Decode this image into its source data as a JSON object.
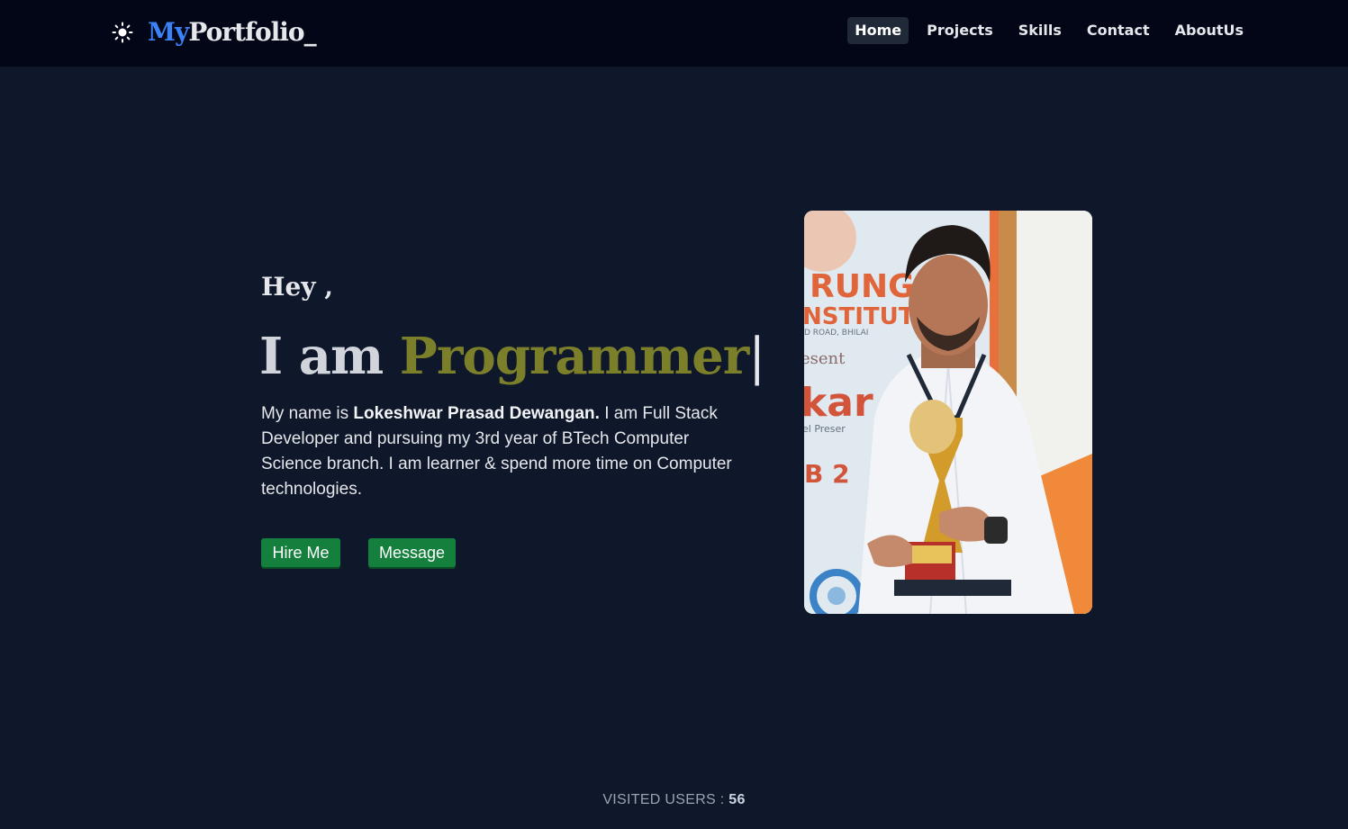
{
  "nav": {
    "theme_icon": "sun-icon",
    "brand_prefix": "My",
    "brand_suffix": "Portfolio_",
    "links": [
      {
        "label": "Home",
        "active": true
      },
      {
        "label": "Projects",
        "active": false
      },
      {
        "label": "Skills",
        "active": false
      },
      {
        "label": "Contact",
        "active": false
      },
      {
        "label": "AboutUs",
        "active": false
      }
    ]
  },
  "hero": {
    "greeting": "Hey ,",
    "headline_prefix": "I am",
    "headline_role": "Programmer",
    "cursor": "|",
    "bio_prefix": "My name is ",
    "bio_name": "Lokeshwar Prasad Dewangan.",
    "bio_suffix": " I am Full Stack Developer and pursuing my 3rd year of BTech Computer Science branch. I am learner & spend more time on Computer technologies.",
    "hire_button": "Hire Me",
    "message_button": "Message"
  },
  "photo": {
    "sign_line1": "RUNG",
    "sign_line2": "NSTITUT",
    "sign_line3": "D ROAD, BHILAI",
    "sign_line4": "esent",
    "sign_line5": "kar",
    "sign_line6": "el Preser",
    "sign_line7": "B 2"
  },
  "footer": {
    "label": "VISITED USERS : ",
    "count": "56"
  },
  "colors": {
    "background": "#0f172a",
    "navbar": "#020617",
    "brand_accent": "#3b82f6",
    "role_accent": "#7c7f2a",
    "button": "#15803d"
  }
}
